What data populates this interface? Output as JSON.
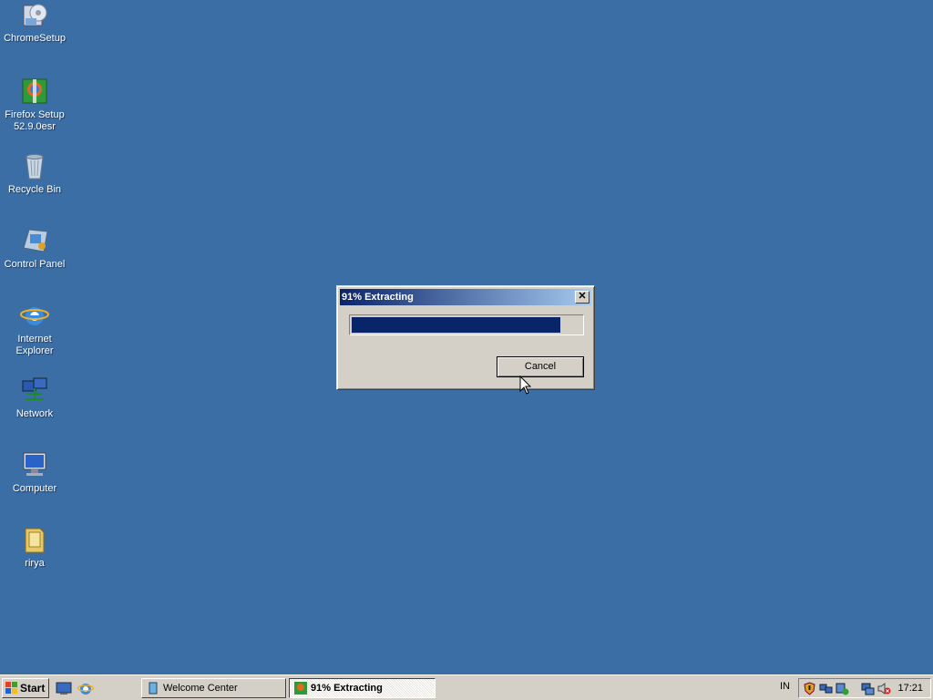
{
  "desktop": {
    "icons": [
      {
        "label": "ChromeSetup"
      },
      {
        "label": "Firefox Setup 52.9.0esr"
      },
      {
        "label": "Recycle Bin"
      },
      {
        "label": "Control Panel"
      },
      {
        "label": "Internet Explorer"
      },
      {
        "label": "Network"
      },
      {
        "label": "Computer"
      },
      {
        "label": "rirya"
      }
    ]
  },
  "dialog": {
    "title": "91% Extracting",
    "progress_fraction": 0.91,
    "cancel_label": "Cancel",
    "close_glyph": "✕"
  },
  "taskbar": {
    "start_label": "Start",
    "tasks": [
      {
        "label": "Welcome Center"
      },
      {
        "label": "91% Extracting"
      }
    ],
    "language": "IN",
    "clock": "17:21"
  },
  "colors": {
    "desktop_bg": "#3a6ea5",
    "progress_fill": "#0a246a",
    "title_gradient_start": "#0a246a",
    "title_gradient_end": "#a6caf0"
  }
}
